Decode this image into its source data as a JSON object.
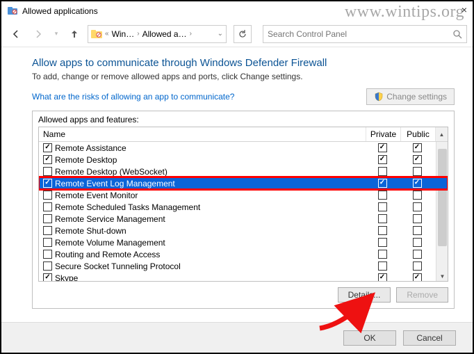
{
  "window": {
    "title": "Allowed applications"
  },
  "watermark": "www.wintips.org",
  "breadcrumb": {
    "seg1": "Win…",
    "seg2": "Allowed a…"
  },
  "search": {
    "placeholder": "Search Control Panel"
  },
  "header": {
    "title": "Allow apps to communicate through Windows Defender Firewall",
    "subtitle": "To add, change or remove allowed apps and ports, click Change settings.",
    "risks_link": "What are the risks of allowing an app to communicate?",
    "change_settings": "Change settings"
  },
  "panel": {
    "label": "Allowed apps and features:",
    "col_name": "Name",
    "col_private": "Private",
    "col_public": "Public",
    "details": "Details...",
    "remove": "Remove"
  },
  "rows": [
    {
      "name": "Remote Assistance",
      "checked": true,
      "private": true,
      "public": true,
      "selected": false
    },
    {
      "name": "Remote Desktop",
      "checked": true,
      "private": true,
      "public": true,
      "selected": false
    },
    {
      "name": "Remote Desktop (WebSocket)",
      "checked": false,
      "private": false,
      "public": false,
      "selected": false
    },
    {
      "name": "Remote Event Log Management",
      "checked": true,
      "private": true,
      "public": true,
      "selected": true,
      "highlighted": true
    },
    {
      "name": "Remote Event Monitor",
      "checked": false,
      "private": false,
      "public": false,
      "selected": false
    },
    {
      "name": "Remote Scheduled Tasks Management",
      "checked": false,
      "private": false,
      "public": false,
      "selected": false
    },
    {
      "name": "Remote Service Management",
      "checked": false,
      "private": false,
      "public": false,
      "selected": false
    },
    {
      "name": "Remote Shut-down",
      "checked": false,
      "private": false,
      "public": false,
      "selected": false
    },
    {
      "name": "Remote Volume Management",
      "checked": false,
      "private": false,
      "public": false,
      "selected": false
    },
    {
      "name": "Routing and Remote Access",
      "checked": false,
      "private": false,
      "public": false,
      "selected": false
    },
    {
      "name": "Secure Socket Tunneling Protocol",
      "checked": false,
      "private": false,
      "public": false,
      "selected": false
    },
    {
      "name": "Skype",
      "checked": true,
      "private": true,
      "public": true,
      "selected": false
    }
  ],
  "footer": {
    "ok": "OK",
    "cancel": "Cancel"
  }
}
